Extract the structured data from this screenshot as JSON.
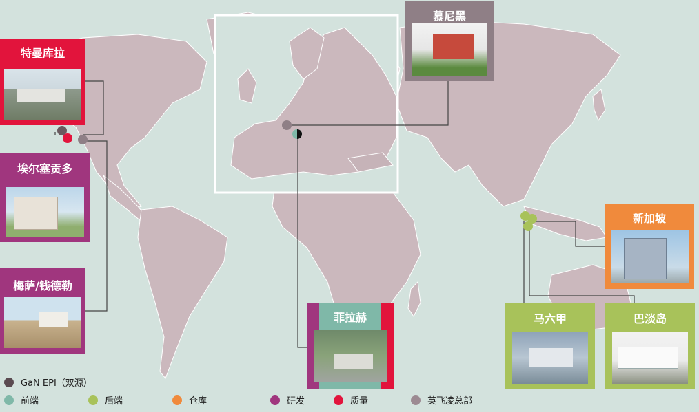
{
  "sites": {
    "torrance": "特曼库拉",
    "el_segundo": "埃尔塞贡多",
    "mesa": "梅萨/钱德勒",
    "munich": "慕尼黑",
    "villach": "菲拉赫",
    "singapore": "新加坡",
    "malacca": "马六甲",
    "batam": "巴淡岛"
  },
  "legend": [
    {
      "label": "GaN EPI（双源）",
      "color": "#5a4a50"
    },
    {
      "label": "前端",
      "color": "#7fb8a8"
    },
    {
      "label": "后端",
      "color": "#a8c25a"
    },
    {
      "label": "仓库",
      "color": "#f08a3c"
    },
    {
      "label": "研发",
      "color": "#a0367e"
    },
    {
      "label": "质量",
      "color": "#e2143c"
    },
    {
      "label": "英飞凌总部",
      "color": "#9c8a92"
    }
  ],
  "colors": {
    "ocean": "#d3e2dd",
    "land": "#cbb8bd",
    "quality_red": "#e2143c",
    "rd_magenta": "#a0367e",
    "hq_gray": "#8f7f86",
    "backend_green": "#a8c25a",
    "warehouse_orange": "#f08a3c"
  }
}
